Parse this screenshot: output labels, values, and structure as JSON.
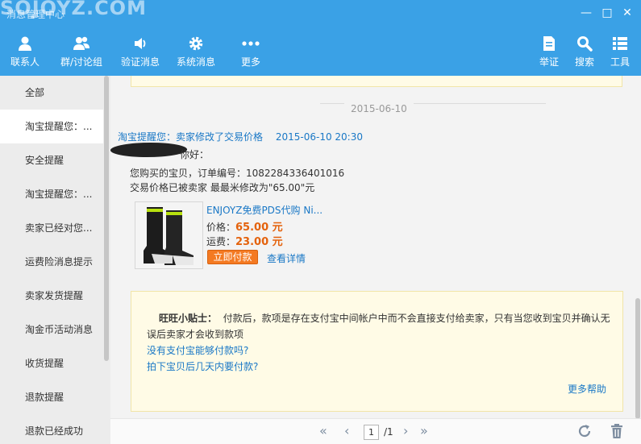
{
  "window": {
    "title": "消息管理中心",
    "watermark": "SOJOYZ.COM",
    "controls": {
      "minimize": "—",
      "restore": "□",
      "close": "✕"
    }
  },
  "toolbar": {
    "left": [
      {
        "label": "联系人",
        "icon": "contact-icon"
      },
      {
        "label": "群/讨论组",
        "icon": "group-icon"
      },
      {
        "label": "验证消息",
        "icon": "speaker-icon"
      },
      {
        "label": "系统消息",
        "icon": "gear-icon"
      },
      {
        "label": "更多",
        "icon": "more-icon"
      }
    ],
    "right": [
      {
        "label": "举证",
        "icon": "report-icon"
      },
      {
        "label": "搜索",
        "icon": "search-icon"
      },
      {
        "label": "工具",
        "icon": "tools-icon"
      }
    ]
  },
  "sidebar": {
    "items": [
      {
        "label": "全部"
      },
      {
        "label": "淘宝提醒您：..."
      },
      {
        "label": "安全提醒"
      },
      {
        "label": "淘宝提醒您：..."
      },
      {
        "label": "卖家已经对您..."
      },
      {
        "label": "运费险消息提示"
      },
      {
        "label": "卖家发货提醒"
      },
      {
        "label": "淘金币活动消息"
      },
      {
        "label": "收货提醒"
      },
      {
        "label": "退款提醒"
      },
      {
        "label": "退款已经成功"
      }
    ]
  },
  "message": {
    "date": "2015-06-10",
    "header_link": "淘宝提醒您：卖家修改了交易价格",
    "time": "2015-06-10 20:30",
    "greeting": "你好：",
    "order_line": "您购买的宝贝，订单编号：1082284336401016",
    "price_line": "交易价格已被卖家 最最米修改为\"65.00\"元",
    "product": {
      "name": "ENJOYZ免费PDS代购  Ni...",
      "price_label": "价格：",
      "price": "65.00 元",
      "shipping_label": "运费：",
      "shipping": "23.00 元",
      "pay_button": "立即付款",
      "detail_link": "查看详情"
    }
  },
  "tip": {
    "title": "旺旺小贴士：",
    "body": "付款后，款项是存在支付宝中间帐户中而不会直接支付给卖家，只有当您收到宝贝并确认无误后卖家才会收到款项",
    "links": [
      "没有支付宝能够付款吗?",
      "拍下宝贝后几天内要付款?"
    ],
    "more_help": "更多帮助"
  },
  "pagination": {
    "first": "«",
    "prev": "‹",
    "page": "1",
    "total": "/1",
    "next": "›",
    "last": "»"
  },
  "colors": {
    "header_bg": "#3aa1e6",
    "link": "#1a78c6",
    "price": "#e4620c",
    "pay_button": "#f47a22",
    "tip_bg": "#fffbe6"
  }
}
